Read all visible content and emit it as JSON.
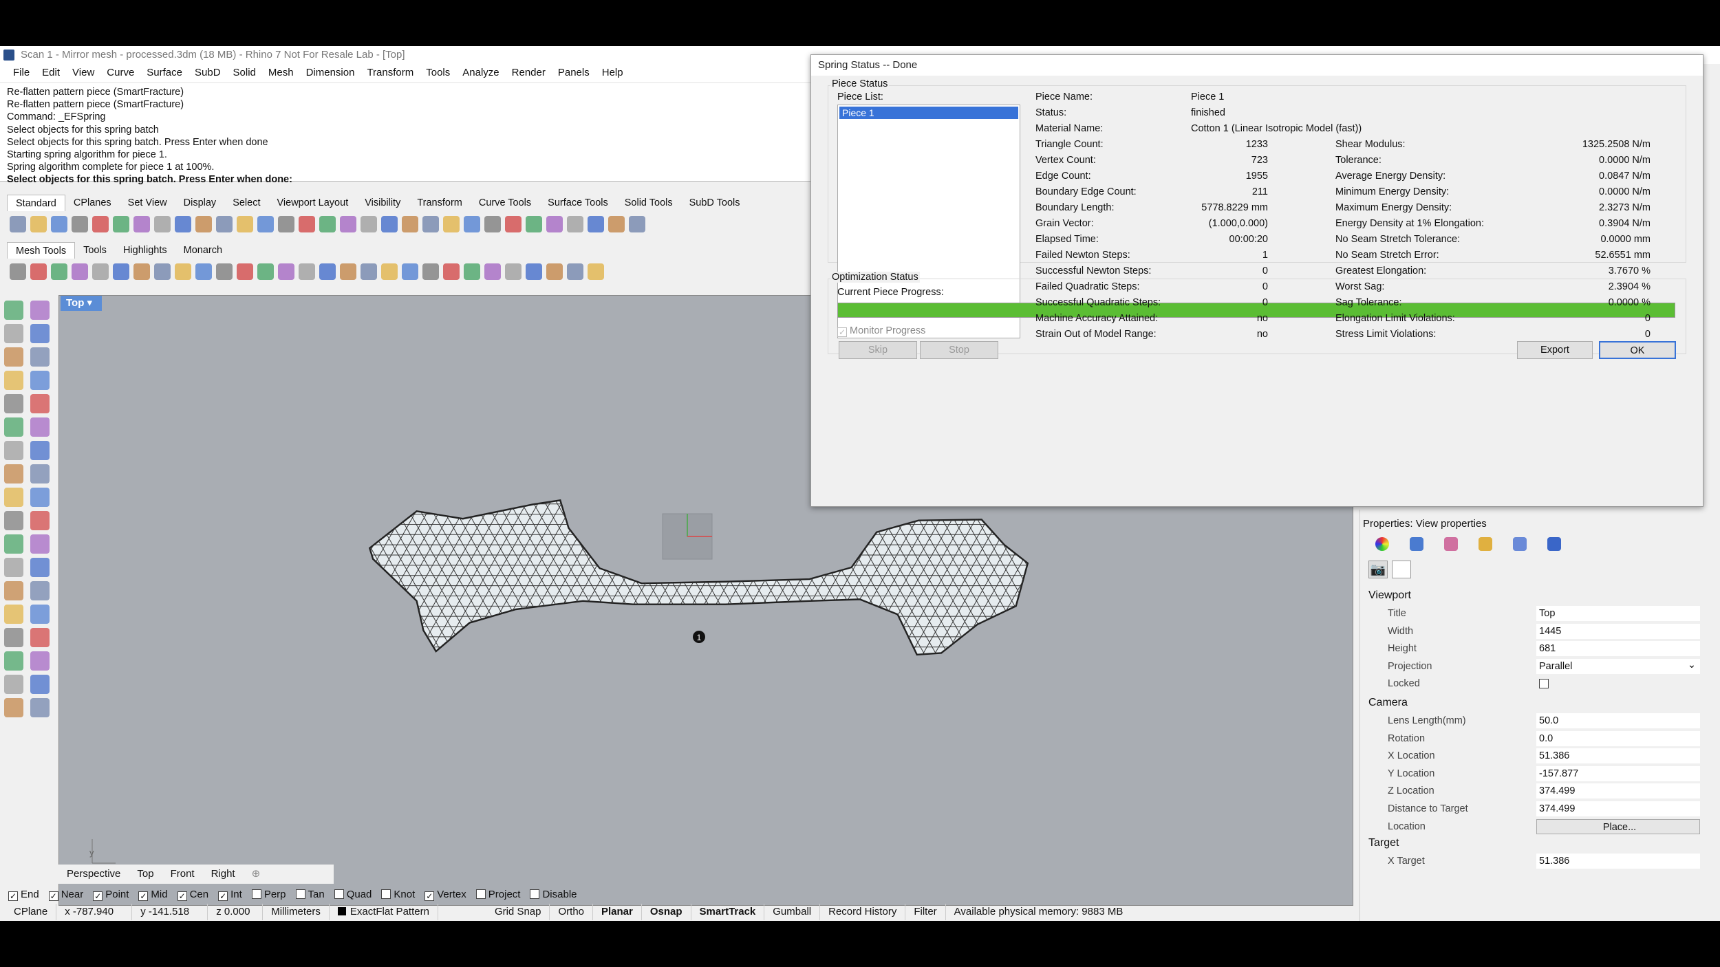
{
  "window": {
    "title": "Scan 1 - Mirror mesh - processed.3dm (18 MB) - Rhino 7 Not For Resale Lab - [Top]"
  },
  "menu": [
    "File",
    "Edit",
    "View",
    "Curve",
    "Surface",
    "SubD",
    "Solid",
    "Mesh",
    "Dimension",
    "Transform",
    "Tools",
    "Analyze",
    "Render",
    "Panels",
    "Help"
  ],
  "command_history": [
    "Re-flatten pattern piece (SmartFracture)",
    "Re-flatten pattern piece (SmartFracture)",
    "Command: _EFSpring",
    "Select objects for this spring batch",
    "Select objects for this spring batch. Press Enter when done",
    "Starting spring algorithm for piece 1.",
    "Spring algorithm complete for piece 1 at 100%.",
    "Select objects for this spring batch. Press Enter when done:"
  ],
  "toolbar_tabs": [
    "Standard",
    "CPlanes",
    "Set View",
    "Display",
    "Select",
    "Viewport Layout",
    "Visibility",
    "Transform",
    "Curve Tools",
    "Surface Tools",
    "Solid Tools",
    "SubD Tools"
  ],
  "toolbar_tabs2": [
    "Mesh Tools",
    "Tools",
    "Highlights",
    "Monarch"
  ],
  "viewport": {
    "label": "Top",
    "axis_x": "x",
    "axis_y": "y"
  },
  "view_tabs": [
    "Perspective",
    "Top",
    "Front",
    "Right"
  ],
  "osnaps": [
    {
      "label": "End",
      "checked": true
    },
    {
      "label": "Near",
      "checked": true
    },
    {
      "label": "Point",
      "checked": true
    },
    {
      "label": "Mid",
      "checked": true
    },
    {
      "label": "Cen",
      "checked": true
    },
    {
      "label": "Int",
      "checked": true
    },
    {
      "label": "Perp",
      "checked": false
    },
    {
      "label": "Tan",
      "checked": false
    },
    {
      "label": "Quad",
      "checked": false
    },
    {
      "label": "Knot",
      "checked": false
    },
    {
      "label": "Vertex",
      "checked": true
    },
    {
      "label": "Project",
      "checked": false
    },
    {
      "label": "Disable",
      "checked": false
    }
  ],
  "status": {
    "cplane": "CPlane",
    "x": "x -787.940",
    "y": "y -141.518",
    "z": "z 0.000",
    "units": "Millimeters",
    "layer": "ExactFlat Pattern",
    "grid_snap": "Grid Snap",
    "ortho": "Ortho",
    "planar": "Planar",
    "osnap": "Osnap",
    "smarttrack": "SmartTrack",
    "gumball": "Gumball",
    "record_history": "Record History",
    "filter": "Filter",
    "memory": "Available physical memory: 9883 MB"
  },
  "dialog": {
    "title": "Spring Status -- Done",
    "piece_status": "Piece Status",
    "piece_list_label": "Piece List:",
    "piece_list": [
      "Piece 1"
    ],
    "piece_name_label": "Piece Name:",
    "piece_name": "Piece 1",
    "status_label": "Status:",
    "status": "finished",
    "material_label": "Material Name:",
    "material": "Cotton 1 (Linear Isotropic Model (fast))",
    "left_stats": [
      {
        "label": "Triangle Count:",
        "value": "1233"
      },
      {
        "label": "Vertex Count:",
        "value": "723"
      },
      {
        "label": "Edge Count:",
        "value": "1955"
      },
      {
        "label": "Boundary Edge Count:",
        "value": "211"
      },
      {
        "label": "Boundary Length:",
        "value": "5778.8229 mm"
      },
      {
        "label": "Grain Vector:",
        "value": "(1.000,0.000)"
      },
      {
        "label": "Elapsed Time:",
        "value": "00:00:20"
      },
      {
        "label": "Failed Newton Steps:",
        "value": "1"
      },
      {
        "label": "Successful Newton Steps:",
        "value": "0"
      },
      {
        "label": "Failed Quadratic Steps:",
        "value": "0"
      },
      {
        "label": "Successful Quadratic Steps:",
        "value": "0"
      },
      {
        "label": "Machine Accuracy Attained:",
        "value": "no"
      },
      {
        "label": "Strain Out of Model Range:",
        "value": "no"
      }
    ],
    "right_stats": [
      {
        "label": "Shear Modulus:",
        "value": "1325.2508 N/m"
      },
      {
        "label": "Tolerance:",
        "value": "0.0000 N/m"
      },
      {
        "label": "Average Energy Density:",
        "value": "0.0847 N/m"
      },
      {
        "label": "Minimum Energy Density:",
        "value": "0.0000 N/m"
      },
      {
        "label": "Maximum Energy Density:",
        "value": "2.3273 N/m"
      },
      {
        "label": "Energy Density at 1% Elongation:",
        "value": "0.3904 N/m"
      },
      {
        "label": "No Seam Stretch Tolerance:",
        "value": "0.0000 mm"
      },
      {
        "label": "No Seam Stretch Error:",
        "value": "52.6551 mm"
      },
      {
        "label": "Greatest Elongation:",
        "value": "3.7670 %"
      },
      {
        "label": "Worst Sag:",
        "value": "2.3904 %"
      },
      {
        "label": "Sag Tolerance:",
        "value": "0.0000 %"
      },
      {
        "label": "Elongation Limit Violations:",
        "value": "0"
      },
      {
        "label": "Stress Limit Violations:",
        "value": "0"
      }
    ],
    "optimization_status": "Optimization Status",
    "progress_label": "Current Piece Progress:",
    "progress_fraction": 1.0,
    "monitor_label": "Monitor Progress",
    "skip": "Skip",
    "stop": "Stop",
    "export": "Export",
    "ok": "OK"
  },
  "properties": {
    "title": "Properties: View properties",
    "viewport_head": "Viewport",
    "viewport_rows": [
      {
        "label": "Title",
        "value": "Top"
      },
      {
        "label": "Width",
        "value": "1445"
      },
      {
        "label": "Height",
        "value": "681"
      },
      {
        "label": "Projection",
        "value": "Parallel"
      },
      {
        "label": "Locked",
        "value": ""
      }
    ],
    "camera_head": "Camera",
    "camera_rows": [
      {
        "label": "Lens Length(mm)",
        "value": "50.0"
      },
      {
        "label": "Rotation",
        "value": "0.0"
      },
      {
        "label": "X Location",
        "value": "51.386"
      },
      {
        "label": "Y Location",
        "value": "-157.877"
      },
      {
        "label": "Z Location",
        "value": "374.499"
      },
      {
        "label": "Distance to Target",
        "value": "374.499"
      },
      {
        "label": "Location",
        "value": "Place..."
      }
    ],
    "target_head": "Target",
    "target_rows": [
      {
        "label": "X Target",
        "value": "51.386"
      }
    ]
  },
  "colors": {
    "accent": "#3873d8",
    "progress": "#5bbd34",
    "viewport_bg": "#a9adb3",
    "mesh_fill": "#e6ecef"
  }
}
